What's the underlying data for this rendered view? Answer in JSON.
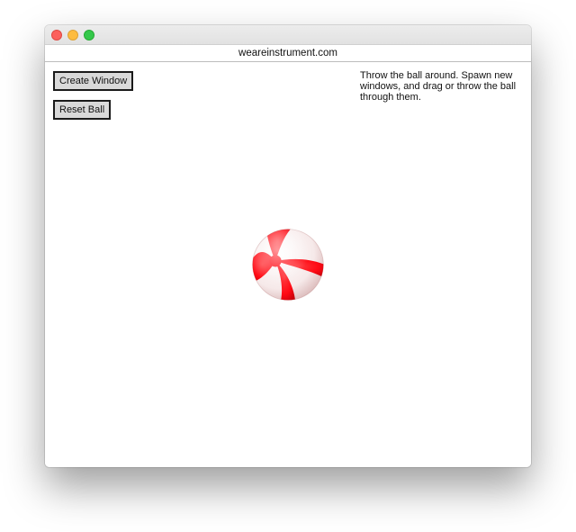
{
  "window": {
    "url": "weareinstrument.com"
  },
  "controls": {
    "create_window_label": "Create Window",
    "reset_ball_label": "Reset Ball"
  },
  "instructions": {
    "text": "Throw the ball around. Spawn new windows, and drag or throw the ball through them."
  },
  "ball": {
    "icon": "beach-ball-icon",
    "colors": {
      "red": "#ff0a14",
      "white": "#ffffff"
    }
  },
  "colors": {
    "traffic_close": "#fc605c",
    "traffic_minimize": "#fdbc40",
    "traffic_zoom": "#34c84a",
    "button_background": "#d9d9d9"
  }
}
